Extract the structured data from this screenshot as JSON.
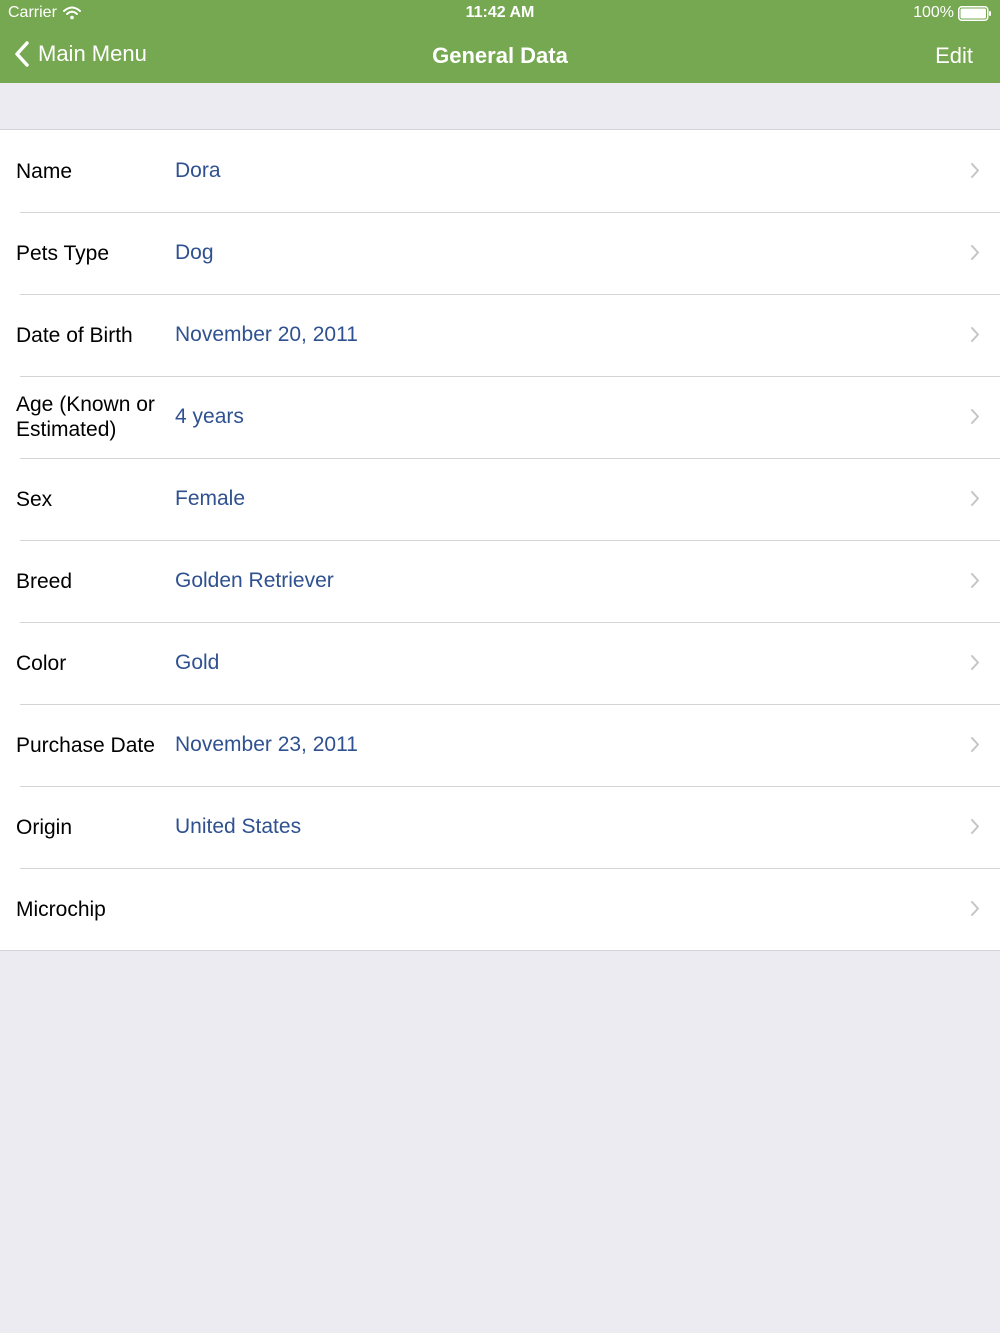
{
  "status_bar": {
    "carrier": "Carrier",
    "time": "11:42 AM",
    "battery": "100%"
  },
  "nav": {
    "back_label": "Main Menu",
    "title": "General Data",
    "edit_label": "Edit"
  },
  "rows": [
    {
      "label": "Name",
      "value": "Dora"
    },
    {
      "label": "Pets Type",
      "value": "Dog"
    },
    {
      "label": "Date of Birth",
      "value": "November 20, 2011"
    },
    {
      "label": "Age (Known or Estimated)",
      "value": "4 years"
    },
    {
      "label": "Sex",
      "value": "Female"
    },
    {
      "label": "Breed",
      "value": "Golden Retriever"
    },
    {
      "label": "Color",
      "value": "Gold"
    },
    {
      "label": "Purchase Date",
      "value": "November 23, 2011"
    },
    {
      "label": "Origin",
      "value": "United States"
    },
    {
      "label": "Microchip",
      "value": ""
    }
  ],
  "colors": {
    "header_bg": "#76a851",
    "value_text": "#2f5190",
    "page_bg": "#ebebf1"
  }
}
